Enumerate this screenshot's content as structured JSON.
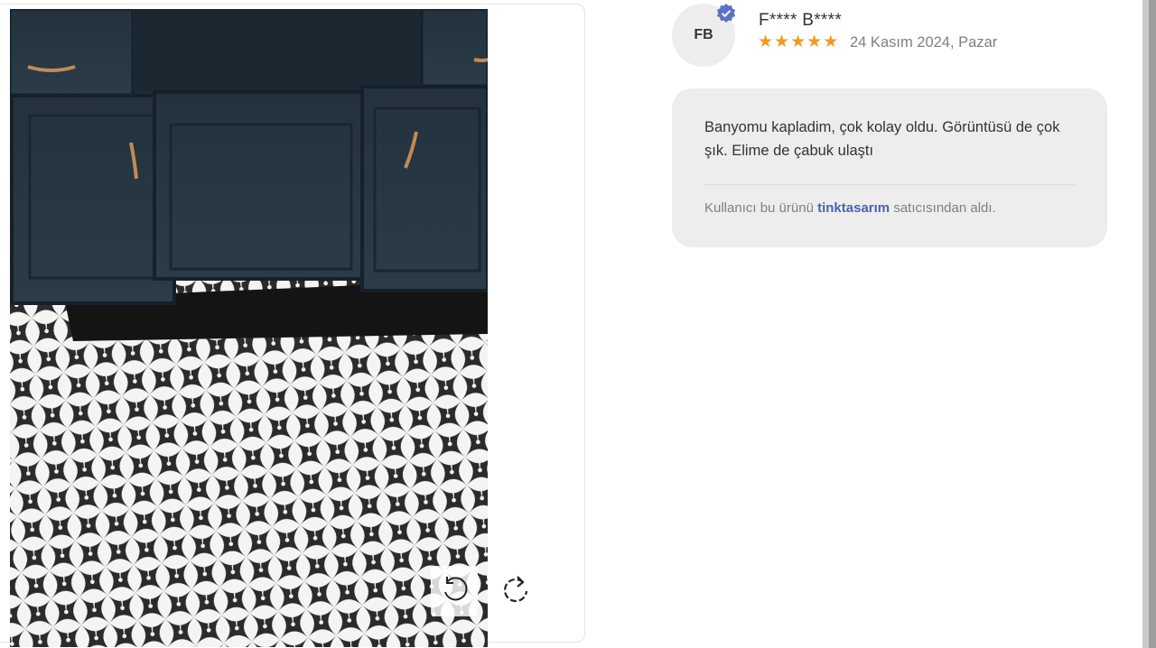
{
  "viewer": {
    "rotate_left_icon": "rotate-counterclockwise-icon",
    "rotate_right_icon": "rotate-clockwise-icon"
  },
  "review": {
    "avatar_initials": "FB",
    "verified_icon": "verified-badge-icon",
    "reviewer_name": "F**** B****",
    "rating": 5,
    "rating_max": 5,
    "date": "24 Kasım 2024, Pazar",
    "text": "Banyomu kapladim, çok kolay oldu. Görüntüsü de çok şık. Elime de çabuk ulaştı",
    "seller_prefix": "Kullanıcı bu ürünü",
    "seller_name": "tinktasarım",
    "seller_suffix": "satıcısından aldı."
  },
  "colors": {
    "star": "#f29a1f",
    "seller_link": "#4a62b6",
    "verified_badge": "#5872c8",
    "bubble_bg": "#ededed"
  }
}
